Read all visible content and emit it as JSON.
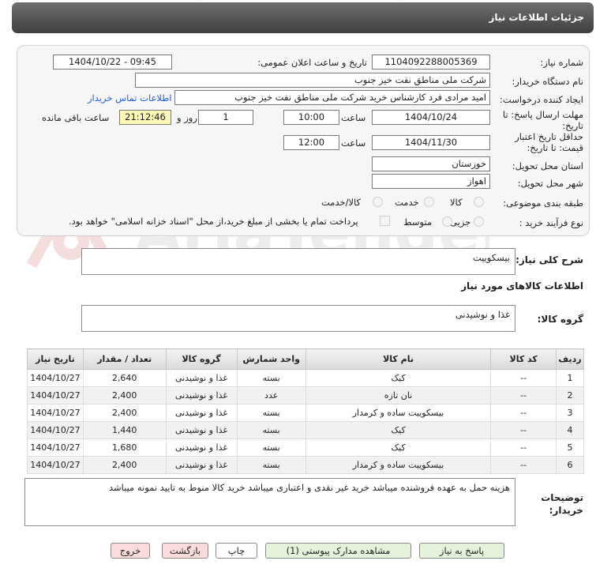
{
  "header": {
    "title": "جزئیات اطلاعات نیاز"
  },
  "watermark": {
    "text": "AriaTender.neT"
  },
  "form": {
    "need_number_label": "شماره نیاز:",
    "need_number": "1104092288005369",
    "announce_label": "تاریخ و ساعت اعلان عمومی:",
    "announce_value": "1404/10/22 - 09:45",
    "buyer_org_label": "نام دستگاه خریدار:",
    "buyer_org": "شرکت ملی مناطق نفت خیز جنوب",
    "creator_label": "ایجاد کننده درخواست:",
    "creator": "امید مرادی فرد کارشناس خرید شرکت ملی مناطق نفت خیز جنوب",
    "contact_link": "اطلاعات تماس خریدار",
    "deadline_label_1": "مهلت ارسال پاسخ: تا",
    "deadline_label_2": "تاریخ:",
    "deadline_date": "1404/10/24",
    "time_label": "ساعت",
    "deadline_time": "10:00",
    "days": "1",
    "days_label": "روز و",
    "remaining_time": "21:12:46",
    "remaining_label": "ساعت باقی مانده",
    "validity_label_1": "حداقل تاریخ اعتبار",
    "validity_label_2": "قیمت: تا تاریخ:",
    "validity_date": "1404/11/30",
    "validity_time_label": "ساعت",
    "validity_time": "12:00",
    "province_label": "استان محل تحویل:",
    "province": "خوزستان",
    "city_label": "شهر محل تحویل:",
    "city": "اهواز",
    "category_label": "طبقه بندی موضوعی:",
    "category_options": [
      "کالا",
      "خدمت",
      "کالا/خدمت"
    ],
    "process_label": "نوع فرآیند خرید :",
    "process_options": [
      "جزیی",
      "متوسط"
    ],
    "payment_note": "پرداخت تمام یا بخشی از مبلغ خرید،از محل \"اسناد خزانه اسلامی\" خواهد بود."
  },
  "summary": {
    "label": "شرح کلی نیاز:",
    "value": "بیسکوییت"
  },
  "goods_info_title": "اطلاعات کالاهای مورد نیاز",
  "goods_group": {
    "label": "گروه کالا:",
    "value": "غذا و نوشیدنی"
  },
  "table": {
    "headers": [
      "ردیف",
      "کد کالا",
      "نام کالا",
      "واحد شمارش",
      "گروه کالا",
      "تعداد / مقدار",
      "تاریخ نیاز"
    ],
    "rows": [
      [
        "1",
        "--",
        "کیک",
        "بسته",
        "غذا و نوشیدنی",
        "2,640",
        "1404/10/27"
      ],
      [
        "2",
        "--",
        "نان تازه",
        "عدد",
        "غذا و نوشیدنی",
        "2,400",
        "1404/10/27"
      ],
      [
        "3",
        "--",
        "بیسکوییت ساده و کرمدار",
        "بسته",
        "غذا و نوشیدنی",
        "2,400",
        "1404/10/27"
      ],
      [
        "4",
        "--",
        "کیک",
        "بسته",
        "غذا و نوشیدنی",
        "1,440",
        "1404/10/27"
      ],
      [
        "5",
        "--",
        "کیک",
        "بسته",
        "غذا و نوشیدنی",
        "1,680",
        "1404/10/27"
      ],
      [
        "6",
        "--",
        "بیسکوییت ساده و کرمدار",
        "بسته",
        "غذا و نوشیدنی",
        "2,400",
        "1404/10/27"
      ]
    ]
  },
  "buyer_notes": {
    "label_1": "توضیحات",
    "label_2": "خریدار:",
    "value": "هزینه حمل به عهده فروشنده میباشد خرید غیر نقدی و اعتباری میباشد خرید کالا منوط به تایید نمونه میباشد"
  },
  "buttons": {
    "reply": "پاسخ به نیاز",
    "attachments": "مشاهده مدارک پیوستی (1)",
    "print": "چاپ",
    "back": "بازگشت",
    "exit": "خروج"
  }
}
